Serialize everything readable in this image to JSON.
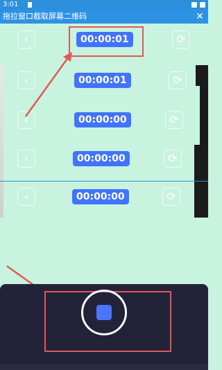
{
  "status_bar": {
    "time": "3:01"
  },
  "title_bar": {
    "title": "拖拉窗口截取屏幕二维码",
    "close_glyph": "✕"
  },
  "rows": [
    {
      "timer": "00:00:01",
      "back_glyph": "‹",
      "refresh_glyph": "⟳"
    },
    {
      "timer": "00:00:01",
      "back_glyph": "‹",
      "refresh_glyph": "⟳"
    },
    {
      "timer": "00:00:00",
      "back_glyph": "‹",
      "refresh_glyph": "⟳"
    },
    {
      "timer": "00:00:00",
      "back_glyph": "‹",
      "refresh_glyph": "⟳"
    },
    {
      "timer": "00:00:00",
      "back_glyph": "‹",
      "refresh_glyph": "⟳"
    }
  ],
  "colors": {
    "background": "#c7f3df",
    "title_bar": "#2e92e4",
    "timer_badge": "#4173ff",
    "annotation": "#e25757",
    "bottom_panel": "#222338",
    "stop_button": "#4b74ff"
  },
  "icons": {
    "back": "chevron-left-icon",
    "refresh": "refresh-icon",
    "close": "close-icon",
    "stop": "stop-icon"
  }
}
